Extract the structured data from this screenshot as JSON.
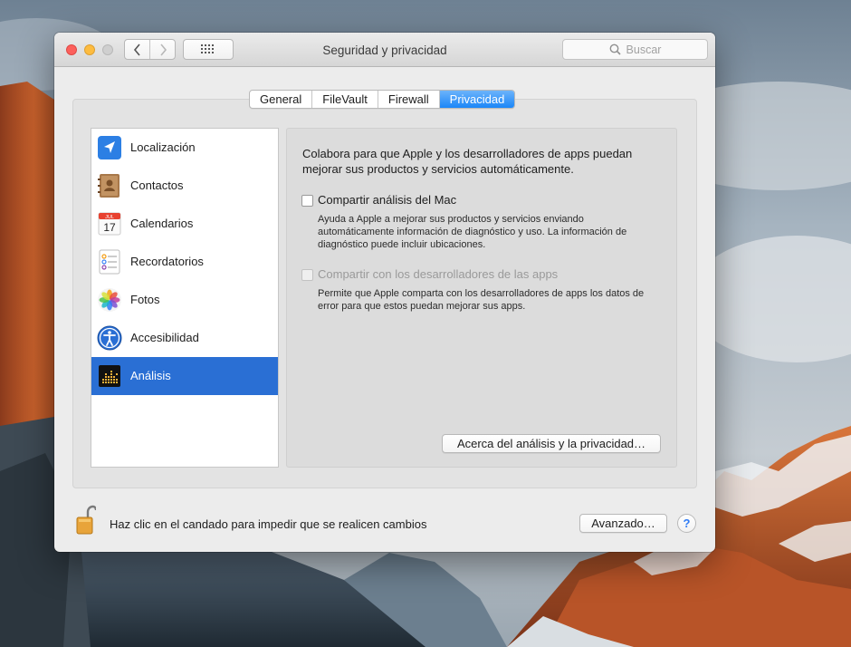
{
  "window": {
    "title": "Seguridad y privacidad",
    "search_placeholder": "Buscar",
    "nav_back": "‹",
    "nav_forward": "›"
  },
  "tabs": [
    {
      "label": "General",
      "active": false
    },
    {
      "label": "FileVault",
      "active": false
    },
    {
      "label": "Firewall",
      "active": false
    },
    {
      "label": "Privacidad",
      "active": true
    }
  ],
  "sidebar": {
    "items": [
      {
        "label": "Localización",
        "icon": "location-arrow-icon"
      },
      {
        "label": "Contactos",
        "icon": "contacts-book-icon"
      },
      {
        "label": "Calendarios",
        "icon": "calendar-icon",
        "icon_text_month": "JUL",
        "icon_text_day": "17"
      },
      {
        "label": "Recordatorios",
        "icon": "reminders-icon"
      },
      {
        "label": "Fotos",
        "icon": "photos-icon"
      },
      {
        "label": "Accesibilidad",
        "icon": "accessibility-icon"
      },
      {
        "label": "Análisis",
        "icon": "analytics-icon",
        "selected": true
      }
    ]
  },
  "detail": {
    "intro": "Colabora para que Apple y los desarrolladores de apps puedan mejorar sus productos y servicios automáticamente.",
    "share_mac": {
      "label": "Compartir análisis del Mac",
      "checked": false,
      "enabled": true,
      "description": "Ayuda a Apple a mejorar sus productos y servicios enviando automáticamente información de diagnóstico y uso. La información de diagnóstico puede incluir ubicaciones."
    },
    "share_devs": {
      "label": "Compartir con los desarrolladores de las apps",
      "checked": false,
      "enabled": false,
      "description": "Permite que Apple comparta con los desarrolladores de apps los datos de error para que estos puedan mejorar sus apps."
    },
    "about_button": "Acerca del análisis y la privacidad…"
  },
  "footer": {
    "lock_text": "Haz clic en el candado para impedir que se realicen cambios",
    "advanced_button": "Avanzado…",
    "help_button": "?"
  },
  "colors": {
    "accent": "#2a6fd4",
    "tab_active": "#1b86f8",
    "close": "#fc605c",
    "minimize": "#fdbc40"
  }
}
